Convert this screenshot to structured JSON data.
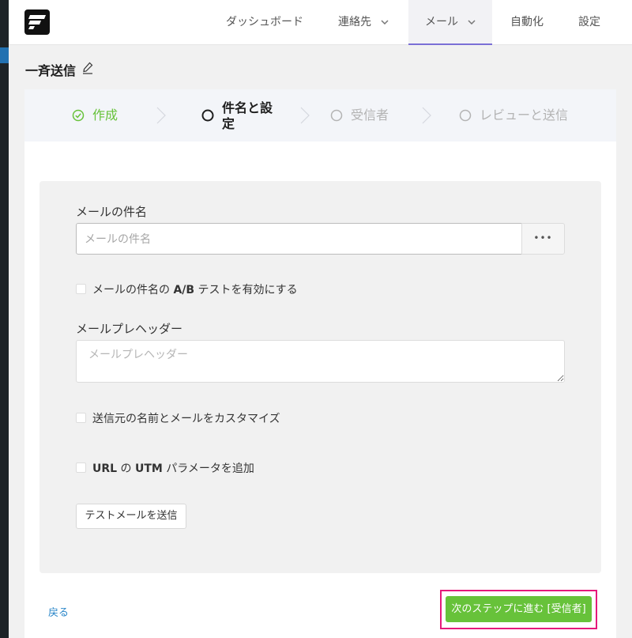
{
  "nav": {
    "dashboard": "ダッシュボード",
    "contacts": "連絡先",
    "email": "メール",
    "automation": "自動化",
    "settings": "設定"
  },
  "page": {
    "title": "一斉送信"
  },
  "steps": [
    {
      "label": "作成",
      "state": "done"
    },
    {
      "label": "件名と設\n定",
      "state": "current"
    },
    {
      "label": "受信者",
      "state": "pending"
    },
    {
      "label": "レビューと送信",
      "state": "pending"
    }
  ],
  "form": {
    "subject_label": "メールの件名",
    "subject_placeholder": "メールの件名",
    "subject_value": "",
    "dots_label": "•••",
    "ab_test_label_a": "メールの件名の ",
    "ab_test_label_b": "A/B",
    "ab_test_label_c": " テストを有効にする",
    "preheader_label": "メールプレヘッダー",
    "preheader_placeholder": "メールプレヘッダー",
    "customize_sender_label": "送信元の名前とメールをカスタマイズ",
    "utm_label_a": "URL",
    "utm_label_b": " の ",
    "utm_label_c": "UTM",
    "utm_label_d": " パラメータを追加",
    "test_email_button": "テストメールを送信"
  },
  "footer": {
    "back_label": "戻る",
    "next_label": "次のステップに進む [受信者]"
  },
  "colors": {
    "accent": "#67c23a",
    "highlight": "#e5197b",
    "link": "#2b87c9",
    "nav_active_border": "#7b6fd6"
  }
}
